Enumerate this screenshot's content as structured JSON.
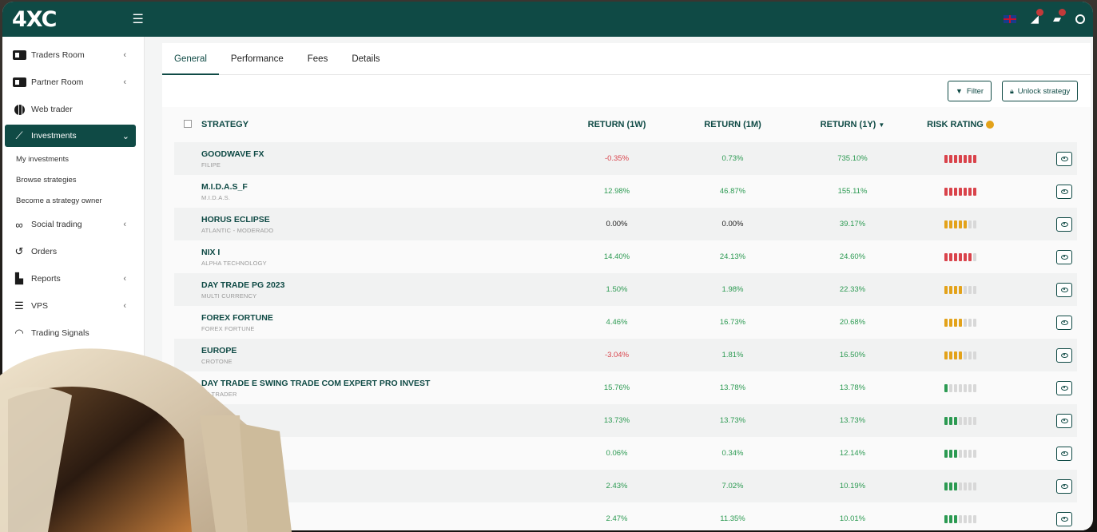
{
  "app": {
    "logo": "4XC"
  },
  "topbar": {
    "icons": [
      "menu-icon",
      "flag-uk-icon",
      "notification-icon",
      "chat-icon",
      "user-icon"
    ]
  },
  "sidebar": {
    "items": [
      {
        "label": "Traders Room",
        "icon": "id-card-icon",
        "chevron": "‹"
      },
      {
        "label": "Partner Room",
        "icon": "id-card-icon",
        "chevron": "‹"
      },
      {
        "label": "Web trader",
        "icon": "globe-icon"
      },
      {
        "label": "Investments",
        "icon": "chart-line-icon",
        "chevron": "⌄",
        "active": true
      },
      {
        "label": "Social trading",
        "icon": "link-icon",
        "chevron": "‹"
      },
      {
        "label": "Orders",
        "icon": "history-icon"
      },
      {
        "label": "Reports",
        "icon": "report-icon",
        "chevron": "‹"
      },
      {
        "label": "VPS",
        "icon": "server-icon",
        "chevron": "‹"
      },
      {
        "label": "Trading Signals",
        "icon": "wifi-icon"
      }
    ],
    "sub_items": [
      "My investments",
      "Browse strategies",
      "Become a strategy owner"
    ]
  },
  "tabs": [
    "General",
    "Performance",
    "Fees",
    "Details"
  ],
  "toolbar": {
    "filter_label": "Filter",
    "unlock_label": "Unlock strategy"
  },
  "table": {
    "headers": {
      "strategy": "STRATEGY",
      "r1w": "RETURN (1W)",
      "r1m": "RETURN (1M)",
      "r1y": "RETURN (1Y)",
      "risk": "RISK RATING"
    },
    "rows": [
      {
        "name": "GOODWAVE FX",
        "sub": "FILIPE",
        "r1w": "-0.35%",
        "r1m": "0.73%",
        "r1y": "735.10%",
        "risk": 7,
        "risk_color": "#d9434b"
      },
      {
        "name": "M.I.D.A.S_F",
        "sub": "M.I.D.A.S.",
        "r1w": "12.98%",
        "r1m": "46.87%",
        "r1y": "155.11%",
        "risk": 7,
        "risk_color": "#d9434b"
      },
      {
        "name": "HORUS ECLIPSE",
        "sub": "ATLANTIC - MODERADO",
        "r1w": "0.00%",
        "r1m": "0.00%",
        "r1y": "39.17%",
        "risk": 5,
        "risk_color": "#e3a21a"
      },
      {
        "name": "NIX I",
        "sub": "ALPHA TECHNOLOGY",
        "r1w": "14.40%",
        "r1m": "24.13%",
        "r1y": "24.60%",
        "risk": 6,
        "risk_color": "#d9434b"
      },
      {
        "name": "DAY TRADE PG 2023",
        "sub": "MULTI CURRENCY",
        "r1w": "1.50%",
        "r1m": "1.98%",
        "r1y": "22.33%",
        "risk": 4,
        "risk_color": "#e3a21a"
      },
      {
        "name": "FOREX FORTUNE",
        "sub": "FOREX FORTUNE",
        "r1w": "4.46%",
        "r1m": "16.73%",
        "r1y": "20.68%",
        "risk": 4,
        "risk_color": "#e3a21a"
      },
      {
        "name": "EUROPE",
        "sub": "CROTONE",
        "r1w": "-3.04%",
        "r1m": "1.81%",
        "r1y": "16.50%",
        "risk": 4,
        "risk_color": "#e3a21a"
      },
      {
        "name": "DAY TRADE E SWING TRADE COM EXPERT PRO INVEST",
        "sub": "PE TRADER",
        "r1w": "15.76%",
        "r1m": "13.78%",
        "r1y": "13.78%",
        "risk": 1,
        "risk_color": "#2c9a52"
      },
      {
        "name": "ADING",
        "sub": "",
        "r1w": "13.73%",
        "r1m": "13.73%",
        "r1y": "13.73%",
        "risk": 3,
        "risk_color": "#2c9a52"
      },
      {
        "name": "THM",
        "sub": "",
        "r1w": "0.06%",
        "r1m": "0.34%",
        "r1y": "12.14%",
        "risk": 3,
        "risk_color": "#2c9a52"
      },
      {
        "name": "",
        "sub": "",
        "r1w": "2.43%",
        "r1m": "7.02%",
        "r1y": "10.19%",
        "risk": 3,
        "risk_color": "#2c9a52"
      },
      {
        "name": "",
        "sub": "",
        "r1w": "2.47%",
        "r1m": "11.35%",
        "r1y": "10.01%",
        "risk": 3,
        "risk_color": "#2c9a52"
      }
    ]
  }
}
